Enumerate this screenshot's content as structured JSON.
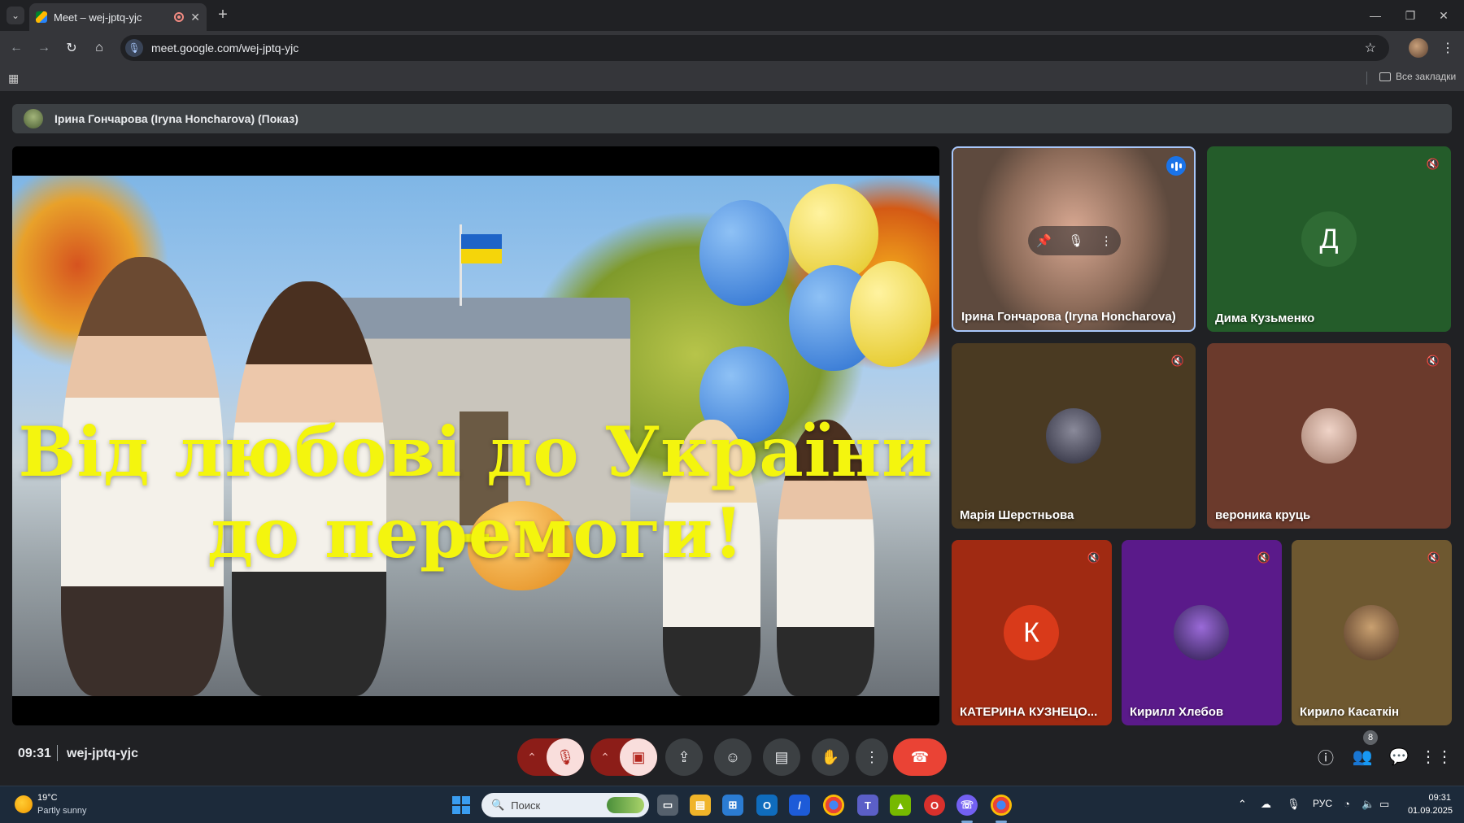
{
  "browser": {
    "tab_title": "Meet – wej-jptq-yjc",
    "url": "meet.google.com/wej-jptq-yjc",
    "bookmarks_all": "Все закладки"
  },
  "meet": {
    "presenting_text": "Ірина Гончарова (Iryna Honcharova) (Показ)",
    "slide_line1": "Від любові до України –",
    "slide_line2": "до перемоги!",
    "participants": [
      {
        "name": "Ірина Гончарова (Iryna Honcharova)",
        "avatar": "video",
        "state": "speaking"
      },
      {
        "name": "Дима Кузьменко",
        "avatar_letter": "Д",
        "state": "muted"
      },
      {
        "name": "Марія Шерстньова",
        "avatar": "photo",
        "state": "muted"
      },
      {
        "name": "вероника круць",
        "avatar": "photo",
        "state": "muted"
      },
      {
        "name": "КАТЕРИНА КУЗНЕЦО...",
        "avatar_letter": "К",
        "state": "muted"
      },
      {
        "name": "Кирилл Хлебов",
        "avatar": "photo",
        "state": "muted"
      },
      {
        "name": "Кирило Касаткін",
        "avatar": "photo",
        "state": "muted"
      }
    ],
    "time": "09:31",
    "meeting_code": "wej-jptq-yjc",
    "people_count": "8"
  },
  "taskbar": {
    "weather_temp": "19°C",
    "weather_desc": "Partly sunny",
    "search_placeholder": "Поиск",
    "language": "РУС",
    "time": "09:31",
    "date": "01.09.2025"
  },
  "colors": {
    "end_call": "#ea4335",
    "muted_ctrl": "#8c1d18",
    "slide_text": "#f4f50e"
  }
}
